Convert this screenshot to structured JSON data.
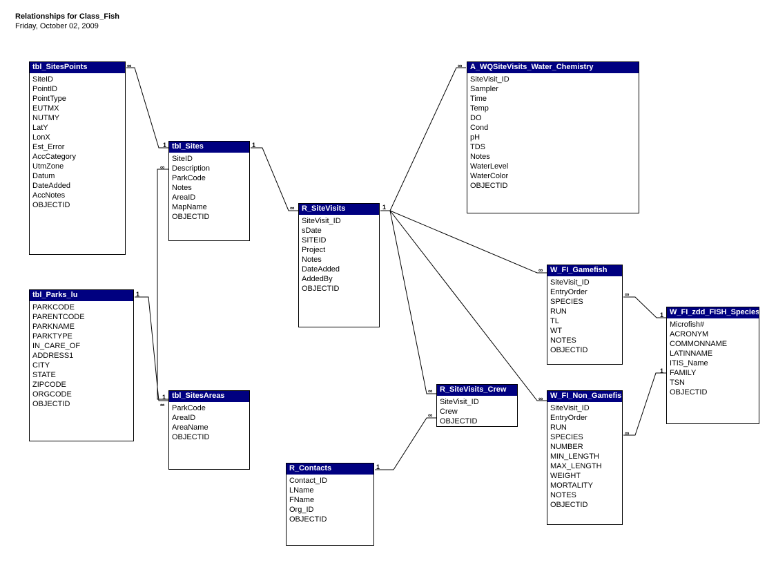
{
  "header": {
    "title": "Relationships for Class_Fish",
    "date": "Friday, October 02, 2009"
  },
  "tables": {
    "tbl_SitesPoints": {
      "title": "tbl_SitesPoints",
      "fields": [
        "SiteID",
        "PointID",
        "PointType",
        "EUTMX",
        "NUTMY",
        "LatY",
        "LonX",
        "Est_Error",
        "AccCategory",
        "UtmZone",
        "Datum",
        "DateAdded",
        "AccNotes",
        "OBJECTID"
      ]
    },
    "tbl_Sites": {
      "title": "tbl_Sites",
      "fields": [
        "SiteID",
        "Description",
        "ParkCode",
        "Notes",
        "AreaID",
        "MapName",
        "OBJECTID"
      ]
    },
    "tbl_Parks_lu": {
      "title": "tbl_Parks_lu",
      "fields": [
        "PARKCODE",
        "PARENTCODE",
        "PARKNAME",
        "PARKTYPE",
        "IN_CARE_OF",
        "ADDRESS1",
        "CITY",
        "STATE",
        "ZIPCODE",
        "ORGCODE",
        "OBJECTID"
      ]
    },
    "tbl_SitesAreas": {
      "title": "tbl_SitesAreas",
      "fields": [
        "ParkCode",
        "AreaID",
        "AreaName",
        "OBJECTID"
      ]
    },
    "R_SiteVisits": {
      "title": "R_SiteVisits",
      "fields": [
        "SiteVisit_ID",
        "sDate",
        "SITEID",
        "Project",
        "Notes",
        "DateAdded",
        "AddedBy",
        "OBJECTID"
      ]
    },
    "R_Contacts": {
      "title": "R_Contacts",
      "fields": [
        "Contact_ID",
        "LName",
        "FName",
        "Org_ID",
        "OBJECTID"
      ]
    },
    "R_SiteVisits_Crew": {
      "title": "R_SiteVisits_Crew",
      "fields": [
        "SiteVisit_ID",
        "Crew",
        "OBJECTID"
      ]
    },
    "A_WQSiteVisits_Water_Chemistry": {
      "title": "A_WQSiteVisits_Water_Chemistry",
      "fields": [
        "SiteVisit_ID",
        "Sampler",
        "Time",
        "Temp",
        "DO",
        "Cond",
        "pH",
        "TDS",
        "Notes",
        "WaterLevel",
        "WaterColor",
        "OBJECTID"
      ]
    },
    "W_FI_Gamefish": {
      "title": "W_FI_Gamefish",
      "fields": [
        "SiteVisit_ID",
        "EntryOrder",
        "SPECIES",
        "RUN",
        "TL",
        "WT",
        "NOTES",
        "OBJECTID"
      ]
    },
    "W_FI_Non_Gamefish": {
      "title": "W_FI_Non_Gamefish",
      "fields": [
        "SiteVisit_ID",
        "EntryOrder",
        "RUN",
        "SPECIES",
        "NUMBER",
        "MIN_LENGTH",
        "MAX_LENGTH",
        "WEIGHT",
        "MORTALITY",
        "NOTES",
        "OBJECTID"
      ]
    },
    "W_FI_zdd_FISH_Species": {
      "title": "W_FI_zdd_FISH_Species",
      "fields": [
        "Microfish#",
        "ACRONYM",
        "COMMONNAME",
        "LATINNAME",
        "ITIS_Name",
        "FAMILY",
        "TSN",
        "OBJECTID"
      ]
    }
  },
  "markers": {
    "one": "1",
    "inf": "∞"
  }
}
